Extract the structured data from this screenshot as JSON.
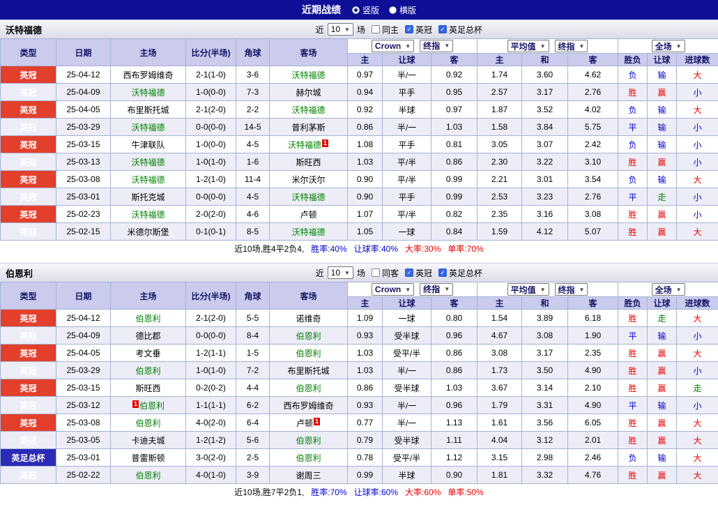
{
  "topbar": {
    "title": "近期战绩",
    "view_options": [
      {
        "label": "竖版",
        "selected": true
      },
      {
        "label": "横版",
        "selected": false
      }
    ]
  },
  "colors": {
    "topbar_bg": "#0e0e96",
    "header_bg": "#cbcbed",
    "league_badge_bg": "#e2402d",
    "cup_badge_bg": "#2b2bb5",
    "tracked_team_green": "#008000",
    "win_red": "#e60000",
    "lose_blue": "#0000cc",
    "push_green": "#008000",
    "row_alt_bg": "#ededf7"
  },
  "sections": [
    {
      "team": "沃特福德",
      "filter": {
        "near_label": "近",
        "count": "10",
        "games_label": "场",
        "checkboxes": [
          {
            "label": "同主",
            "checked": false
          },
          {
            "label": "英冠",
            "checked": true
          },
          {
            "label": "英足总杯",
            "checked": true
          }
        ]
      },
      "selects": {
        "company": "Crown",
        "company_stage": "终指",
        "average": "平均值",
        "average_stage": "终指",
        "scope": "全场"
      },
      "columns": [
        "类型",
        "日期",
        "主场",
        "比分(半场)",
        "角球",
        "客场",
        "主",
        "让球",
        "客",
        "主",
        "和",
        "客",
        "胜负",
        "让球",
        "进球数"
      ],
      "rows": [
        {
          "type": "英冠",
          "type_style": "league",
          "date": "25-04-12",
          "home": {
            "name": "西布罗姆维奇",
            "tracked": false
          },
          "score": "2-1(1-0)",
          "corners": "3-6",
          "away": {
            "name": "沃特福德",
            "tracked": true
          },
          "odds": [
            "0.97",
            "半/一",
            "0.92"
          ],
          "avg": [
            "1.74",
            "3.60",
            "4.62"
          ],
          "results": [
            {
              "text": "负",
              "color": "blue"
            },
            {
              "text": "输",
              "color": "blue"
            },
            {
              "text": "大",
              "color": "red"
            }
          ]
        },
        {
          "type": "英冠",
          "type_style": "league",
          "date": "25-04-09",
          "home": {
            "name": "沃特福德",
            "tracked": true
          },
          "score": "1-0(0-0)",
          "corners": "7-3",
          "away": {
            "name": "赫尔城",
            "tracked": false
          },
          "odds": [
            "0.94",
            "平手",
            "0.95"
          ],
          "avg": [
            "2.57",
            "3.17",
            "2.76"
          ],
          "results": [
            {
              "text": "胜",
              "color": "red"
            },
            {
              "text": "赢",
              "color": "red"
            },
            {
              "text": "小",
              "color": "blue"
            }
          ]
        },
        {
          "type": "英冠",
          "type_style": "league",
          "date": "25-04-05",
          "home": {
            "name": "布里斯托城",
            "tracked": false
          },
          "score": "2-1(2-0)",
          "corners": "2-2",
          "away": {
            "name": "沃特福德",
            "tracked": true
          },
          "odds": [
            "0.92",
            "半球",
            "0.97"
          ],
          "avg": [
            "1.87",
            "3.52",
            "4.02"
          ],
          "results": [
            {
              "text": "负",
              "color": "blue"
            },
            {
              "text": "输",
              "color": "blue"
            },
            {
              "text": "大",
              "color": "red"
            }
          ]
        },
        {
          "type": "英冠",
          "type_style": "league",
          "date": "25-03-29",
          "home": {
            "name": "沃特福德",
            "tracked": true
          },
          "score": "0-0(0-0)",
          "corners": "14-5",
          "away": {
            "name": "普利茅斯",
            "tracked": false
          },
          "odds": [
            "0.86",
            "半/一",
            "1.03"
          ],
          "avg": [
            "1.58",
            "3.84",
            "5.75"
          ],
          "results": [
            {
              "text": "平",
              "color": "blue"
            },
            {
              "text": "输",
              "color": "blue"
            },
            {
              "text": "小",
              "color": "blue"
            }
          ]
        },
        {
          "type": "英冠",
          "type_style": "league",
          "date": "25-03-15",
          "home": {
            "name": "牛津联队",
            "tracked": false
          },
          "score": "1-0(0-0)",
          "corners": "4-5",
          "away": {
            "name": "沃特福德",
            "tracked": true,
            "card_after": "1"
          },
          "odds": [
            "1.08",
            "平手",
            "0.81"
          ],
          "avg": [
            "3.05",
            "3.07",
            "2.42"
          ],
          "results": [
            {
              "text": "负",
              "color": "blue"
            },
            {
              "text": "输",
              "color": "blue"
            },
            {
              "text": "小",
              "color": "blue"
            }
          ]
        },
        {
          "type": "英冠",
          "type_style": "league",
          "date": "25-03-13",
          "home": {
            "name": "沃特福德",
            "tracked": true
          },
          "score": "1-0(1-0)",
          "corners": "1-6",
          "away": {
            "name": "斯旺西",
            "tracked": false
          },
          "odds": [
            "1.03",
            "平/半",
            "0.86"
          ],
          "avg": [
            "2.30",
            "3.22",
            "3.10"
          ],
          "results": [
            {
              "text": "胜",
              "color": "red"
            },
            {
              "text": "赢",
              "color": "red"
            },
            {
              "text": "小",
              "color": "blue"
            }
          ]
        },
        {
          "type": "英冠",
          "type_style": "league",
          "date": "25-03-08",
          "home": {
            "name": "沃特福德",
            "tracked": true
          },
          "score": "1-2(1-0)",
          "corners": "11-4",
          "away": {
            "name": "米尔沃尔",
            "tracked": false
          },
          "odds": [
            "0.90",
            "平/半",
            "0.99"
          ],
          "avg": [
            "2.21",
            "3.01",
            "3.54"
          ],
          "results": [
            {
              "text": "负",
              "color": "blue"
            },
            {
              "text": "输",
              "color": "blue"
            },
            {
              "text": "大",
              "color": "red"
            }
          ]
        },
        {
          "type": "英冠",
          "type_style": "league",
          "date": "25-03-01",
          "home": {
            "name": "斯托克城",
            "tracked": false
          },
          "score": "0-0(0-0)",
          "corners": "4-5",
          "away": {
            "name": "沃特福德",
            "tracked": true
          },
          "odds": [
            "0.90",
            "平手",
            "0.99"
          ],
          "avg": [
            "2.53",
            "3.23",
            "2.76"
          ],
          "results": [
            {
              "text": "平",
              "color": "blue"
            },
            {
              "text": "走",
              "color": "green"
            },
            {
              "text": "小",
              "color": "blue"
            }
          ]
        },
        {
          "type": "英冠",
          "type_style": "league",
          "date": "25-02-23",
          "home": {
            "name": "沃特福德",
            "tracked": true
          },
          "score": "2-0(2-0)",
          "corners": "4-6",
          "away": {
            "name": "卢顿",
            "tracked": false
          },
          "odds": [
            "1.07",
            "平/半",
            "0.82"
          ],
          "avg": [
            "2.35",
            "3.16",
            "3.08"
          ],
          "results": [
            {
              "text": "胜",
              "color": "red"
            },
            {
              "text": "赢",
              "color": "red"
            },
            {
              "text": "小",
              "color": "blue"
            }
          ]
        },
        {
          "type": "英冠",
          "type_style": "league",
          "date": "25-02-15",
          "home": {
            "name": "米德尔斯堡",
            "tracked": false
          },
          "score": "0-1(0-1)",
          "corners": "8-5",
          "away": {
            "name": "沃特福德",
            "tracked": true
          },
          "odds": [
            "1.05",
            "一球",
            "0.84"
          ],
          "avg": [
            "1.59",
            "4.12",
            "5.07"
          ],
          "results": [
            {
              "text": "胜",
              "color": "red"
            },
            {
              "text": "赢",
              "color": "red"
            },
            {
              "text": "大",
              "color": "red"
            }
          ]
        }
      ],
      "summary": {
        "prefix": "近10场,胜4平2负4,",
        "stats": [
          {
            "text": "胜率:40%",
            "color": "blue"
          },
          {
            "text": "让球率:40%",
            "color": "blue"
          },
          {
            "text": "大率:30%",
            "color": "red"
          },
          {
            "text": "单率:70%",
            "color": "red"
          }
        ]
      }
    },
    {
      "team": "伯恩利",
      "filter": {
        "near_label": "近",
        "count": "10",
        "games_label": "场",
        "checkboxes": [
          {
            "label": "同客",
            "checked": false
          },
          {
            "label": "英冠",
            "checked": true
          },
          {
            "label": "英足总杯",
            "checked": true
          }
        ]
      },
      "selects": {
        "company": "Crown",
        "company_stage": "终指",
        "average": "平均值",
        "average_stage": "终指",
        "scope": "全场"
      },
      "columns": [
        "类型",
        "日期",
        "主场",
        "比分(半场)",
        "角球",
        "客场",
        "主",
        "让球",
        "客",
        "主",
        "和",
        "客",
        "胜负",
        "让球",
        "进球数"
      ],
      "rows": [
        {
          "type": "英冠",
          "type_style": "league",
          "date": "25-04-12",
          "home": {
            "name": "伯恩利",
            "tracked": true
          },
          "score": "2-1(2-0)",
          "corners": "5-5",
          "away": {
            "name": "诺维奇",
            "tracked": false
          },
          "odds": [
            "1.09",
            "一球",
            "0.80"
          ],
          "avg": [
            "1.54",
            "3.89",
            "6.18"
          ],
          "results": [
            {
              "text": "胜",
              "color": "red"
            },
            {
              "text": "走",
              "color": "green"
            },
            {
              "text": "大",
              "color": "red"
            }
          ]
        },
        {
          "type": "英冠",
          "type_style": "league",
          "date": "25-04-09",
          "home": {
            "name": "德比郡",
            "tracked": false
          },
          "score": "0-0(0-0)",
          "corners": "8-4",
          "away": {
            "name": "伯恩利",
            "tracked": true
          },
          "odds": [
            "0.93",
            "受半球",
            "0.96"
          ],
          "avg": [
            "4.67",
            "3.08",
            "1.90"
          ],
          "results": [
            {
              "text": "平",
              "color": "blue"
            },
            {
              "text": "输",
              "color": "blue"
            },
            {
              "text": "小",
              "color": "blue"
            }
          ]
        },
        {
          "type": "英冠",
          "type_style": "league",
          "date": "25-04-05",
          "home": {
            "name": "考文垂",
            "tracked": false
          },
          "score": "1-2(1-1)",
          "corners": "1-5",
          "away": {
            "name": "伯恩利",
            "tracked": true
          },
          "odds": [
            "1.03",
            "受平/半",
            "0.86"
          ],
          "avg": [
            "3.08",
            "3.17",
            "2.35"
          ],
          "results": [
            {
              "text": "胜",
              "color": "red"
            },
            {
              "text": "赢",
              "color": "red"
            },
            {
              "text": "大",
              "color": "red"
            }
          ]
        },
        {
          "type": "英冠",
          "type_style": "league",
          "date": "25-03-29",
          "home": {
            "name": "伯恩利",
            "tracked": true
          },
          "score": "1-0(1-0)",
          "corners": "7-2",
          "away": {
            "name": "布里斯托城",
            "tracked": false
          },
          "odds": [
            "1.03",
            "半/一",
            "0.86"
          ],
          "avg": [
            "1.73",
            "3.50",
            "4.90"
          ],
          "results": [
            {
              "text": "胜",
              "color": "red"
            },
            {
              "text": "赢",
              "color": "red"
            },
            {
              "text": "小",
              "color": "blue"
            }
          ]
        },
        {
          "type": "英冠",
          "type_style": "league",
          "date": "25-03-15",
          "home": {
            "name": "斯旺西",
            "tracked": false
          },
          "score": "0-2(0-2)",
          "corners": "4-4",
          "away": {
            "name": "伯恩利",
            "tracked": true
          },
          "odds": [
            "0.86",
            "受半球",
            "1.03"
          ],
          "avg": [
            "3.67",
            "3.14",
            "2.10"
          ],
          "results": [
            {
              "text": "胜",
              "color": "red"
            },
            {
              "text": "赢",
              "color": "red"
            },
            {
              "text": "走",
              "color": "green"
            }
          ]
        },
        {
          "type": "英冠",
          "type_style": "league",
          "date": "25-03-12",
          "home": {
            "name": "伯恩利",
            "tracked": true,
            "card_before": "1"
          },
          "score": "1-1(1-1)",
          "corners": "6-2",
          "away": {
            "name": "西布罗姆维奇",
            "tracked": false
          },
          "odds": [
            "0.93",
            "半/一",
            "0.96"
          ],
          "avg": [
            "1.79",
            "3.31",
            "4.90"
          ],
          "results": [
            {
              "text": "平",
              "color": "blue"
            },
            {
              "text": "输",
              "color": "blue"
            },
            {
              "text": "小",
              "color": "blue"
            }
          ]
        },
        {
          "type": "英冠",
          "type_style": "league",
          "date": "25-03-08",
          "home": {
            "name": "伯恩利",
            "tracked": true
          },
          "score": "4-0(2-0)",
          "corners": "6-4",
          "away": {
            "name": "卢顿",
            "tracked": false,
            "card_after": "1"
          },
          "odds": [
            "0.77",
            "半/一",
            "1.13"
          ],
          "avg": [
            "1.61",
            "3.56",
            "6.05"
          ],
          "results": [
            {
              "text": "胜",
              "color": "red"
            },
            {
              "text": "赢",
              "color": "red"
            },
            {
              "text": "大",
              "color": "red"
            }
          ]
        },
        {
          "type": "英冠",
          "type_style": "league",
          "date": "25-03-05",
          "home": {
            "name": "卡迪夫城",
            "tracked": false
          },
          "score": "1-2(1-2)",
          "corners": "5-6",
          "away": {
            "name": "伯恩利",
            "tracked": true
          },
          "odds": [
            "0.79",
            "受半球",
            "1.11"
          ],
          "avg": [
            "4.04",
            "3.12",
            "2.01"
          ],
          "results": [
            {
              "text": "胜",
              "color": "red"
            },
            {
              "text": "赢",
              "color": "red"
            },
            {
              "text": "大",
              "color": "red"
            }
          ]
        },
        {
          "type": "英足总杯",
          "type_style": "cup",
          "date": "25-03-01",
          "home": {
            "name": "普雷斯顿",
            "tracked": false
          },
          "score": "3-0(2-0)",
          "corners": "2-5",
          "away": {
            "name": "伯恩利",
            "tracked": true
          },
          "odds": [
            "0.78",
            "受平/半",
            "1.12"
          ],
          "avg": [
            "3.15",
            "2.98",
            "2.46"
          ],
          "results": [
            {
              "text": "负",
              "color": "blue"
            },
            {
              "text": "输",
              "color": "blue"
            },
            {
              "text": "大",
              "color": "red"
            }
          ]
        },
        {
          "type": "英冠",
          "type_style": "league",
          "date": "25-02-22",
          "home": {
            "name": "伯恩利",
            "tracked": true
          },
          "score": "4-0(1-0)",
          "corners": "3-9",
          "away": {
            "name": "谢周三",
            "tracked": false
          },
          "odds": [
            "0.99",
            "半球",
            "0.90"
          ],
          "avg": [
            "1.81",
            "3.32",
            "4.76"
          ],
          "results": [
            {
              "text": "胜",
              "color": "red"
            },
            {
              "text": "赢",
              "color": "red"
            },
            {
              "text": "大",
              "color": "red"
            }
          ]
        }
      ],
      "summary": {
        "prefix": "近10场,胜7平2负1,",
        "stats": [
          {
            "text": "胜率:70%",
            "color": "blue"
          },
          {
            "text": "让球率:60%",
            "color": "blue"
          },
          {
            "text": "大率:60%",
            "color": "red"
          },
          {
            "text": "单率:50%",
            "color": "red"
          }
        ]
      }
    }
  ]
}
